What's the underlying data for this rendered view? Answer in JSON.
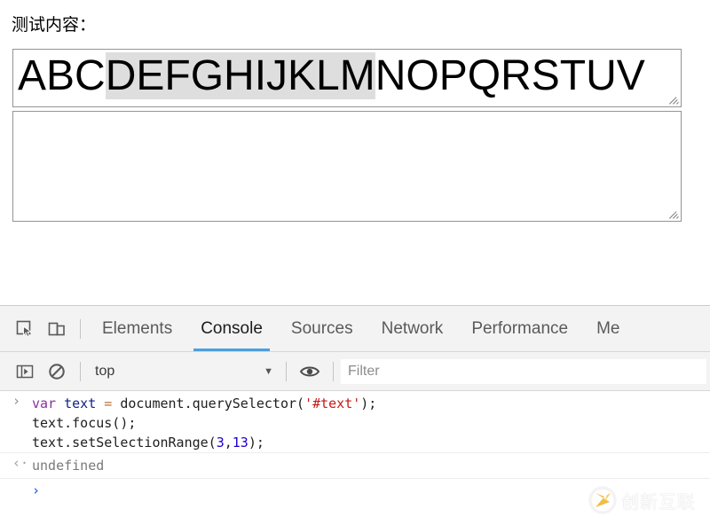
{
  "page": {
    "field_label": "测试内容：",
    "textarea_primary": {
      "value": "ABCDEFGHIJKLMNOPQRSTUV",
      "before_selection": "ABC",
      "selected": "DEFGHIJKLM",
      "after_selection": "NOPQRSTUV",
      "selection_start": 3,
      "selection_end": 13
    },
    "textarea_secondary": {
      "value": "",
      "placeholder": ""
    }
  },
  "devtools": {
    "tabs": [
      {
        "label": "Elements",
        "active": false
      },
      {
        "label": "Console",
        "active": true
      },
      {
        "label": "Sources",
        "active": false
      },
      {
        "label": "Network",
        "active": false
      },
      {
        "label": "Performance",
        "active": false
      },
      {
        "label": "Me",
        "active": false
      }
    ],
    "toolbar_icons": {
      "inspect": "inspect-element-icon",
      "device": "device-toolbar-icon"
    },
    "filterbar": {
      "sidebar_toggle": "console-sidebar-icon",
      "clear_console": "clear-console-icon",
      "context_value": "top",
      "context_chevron": "▼",
      "eye_icon": "live-expression-eye-icon",
      "filter_placeholder": "Filter",
      "filter_value": ""
    },
    "console": {
      "input_gutter": "›",
      "output_gutter": "‹·",
      "prompt_gutter": "›",
      "lines": [
        {
          "tokens": [
            {
              "t": "var",
              "c": "kw"
            },
            {
              "t": " ",
              "c": "plain"
            },
            {
              "t": "text",
              "c": "var"
            },
            {
              "t": " ",
              "c": "plain"
            },
            {
              "t": "=",
              "c": "op"
            },
            {
              "t": " document.querySelector(",
              "c": "plain"
            },
            {
              "t": "'#text'",
              "c": "str"
            },
            {
              "t": ");",
              "c": "plain"
            }
          ]
        },
        {
          "tokens": [
            {
              "t": "text.focus();",
              "c": "plain"
            }
          ]
        },
        {
          "tokens": [
            {
              "t": "text.setSelectionRange(",
              "c": "plain"
            },
            {
              "t": "3",
              "c": "num"
            },
            {
              "t": ",",
              "c": "plain"
            },
            {
              "t": "13",
              "c": "num"
            },
            {
              "t": ");",
              "c": "plain"
            }
          ]
        }
      ],
      "result": "undefined"
    }
  },
  "watermark": {
    "text": "创新互联",
    "logo": "chuangxin-hulian-logo-icon"
  },
  "colors": {
    "accent_tab_underline": "#4c9fdd",
    "selection_highlight": "#dedede",
    "devtools_chrome": "#f3f3f3",
    "string_token": "#c41a16",
    "keyword_token": "#8a2fa0",
    "number_token": "#1c00cf"
  }
}
